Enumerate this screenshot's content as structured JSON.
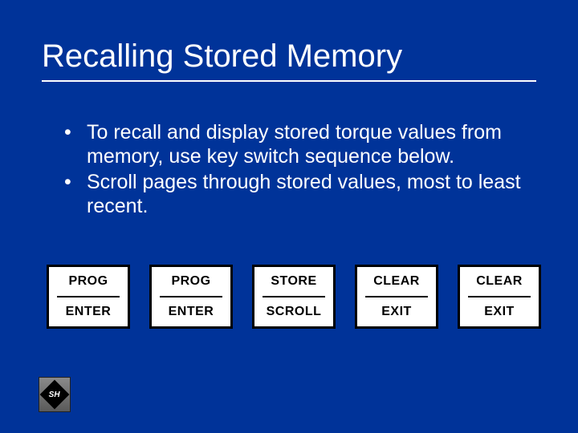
{
  "title": "Recalling Stored Memory",
  "bullets": [
    "To recall and display stored torque values from memory, use key switch sequence below.",
    "Scroll pages through stored values, most to least recent."
  ],
  "keys": [
    {
      "top": "PROG",
      "bottom": "ENTER"
    },
    {
      "top": "PROG",
      "bottom": "ENTER"
    },
    {
      "top": "STORE",
      "bottom": "SCROLL"
    },
    {
      "top": "CLEAR",
      "bottom": "EXIT"
    },
    {
      "top": "CLEAR",
      "bottom": "EXIT"
    }
  ],
  "logo_text": "SH"
}
